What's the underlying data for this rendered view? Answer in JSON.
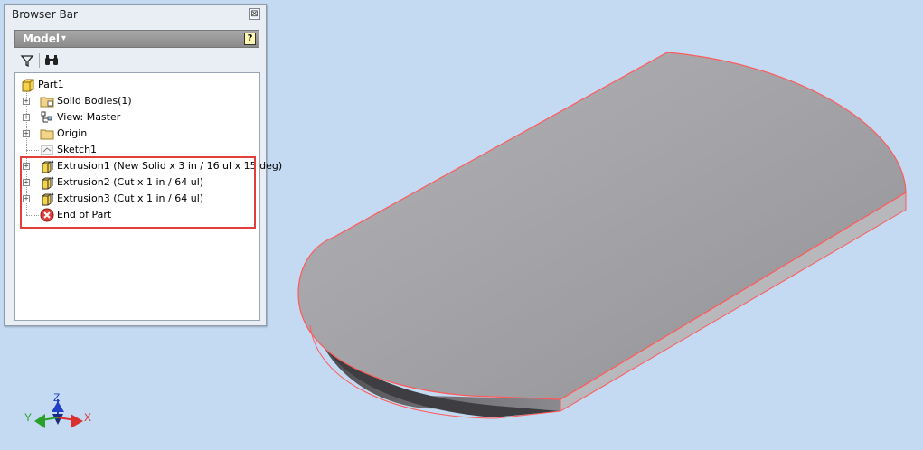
{
  "panel": {
    "title": "Browser Bar",
    "close_glyph": "⊠"
  },
  "model_header": {
    "label": "Model",
    "caret": "▾",
    "help_glyph": "?"
  },
  "toolbar": {
    "filter_icon": "filter-icon",
    "find_icon": "binoculars-icon"
  },
  "tree": {
    "root": "Part1",
    "items": [
      {
        "label": "Solid Bodies(1)",
        "icon": "solid-bodies-folder-icon"
      },
      {
        "label": "View: Master",
        "icon": "view-icon"
      },
      {
        "label": "Origin",
        "icon": "origin-folder-icon"
      },
      {
        "label": "Sketch1",
        "icon": "sketch-icon"
      },
      {
        "label": "Extrusion1 (New Solid x 3 in / 16 ul x 15 deg)",
        "icon": "extrusion-icon"
      },
      {
        "label": "Extrusion2 (Cut x 1 in / 64 ul)",
        "icon": "extrusion-icon"
      },
      {
        "label": "Extrusion3 (Cut x 1 in / 64 ul)",
        "icon": "extrusion-icon"
      },
      {
        "label": "End of Part",
        "icon": "end-of-part-icon"
      }
    ]
  },
  "triad": {
    "z": "Z",
    "y": "Y",
    "x": "X"
  },
  "colors": {
    "background": "#c4daf2",
    "highlight": "#e0403a",
    "edge": "#ff5a5a",
    "face_top": "#9b9ba0",
    "axis_x": "#d83030",
    "axis_y": "#2aa02a",
    "axis_z": "#2040c8"
  }
}
